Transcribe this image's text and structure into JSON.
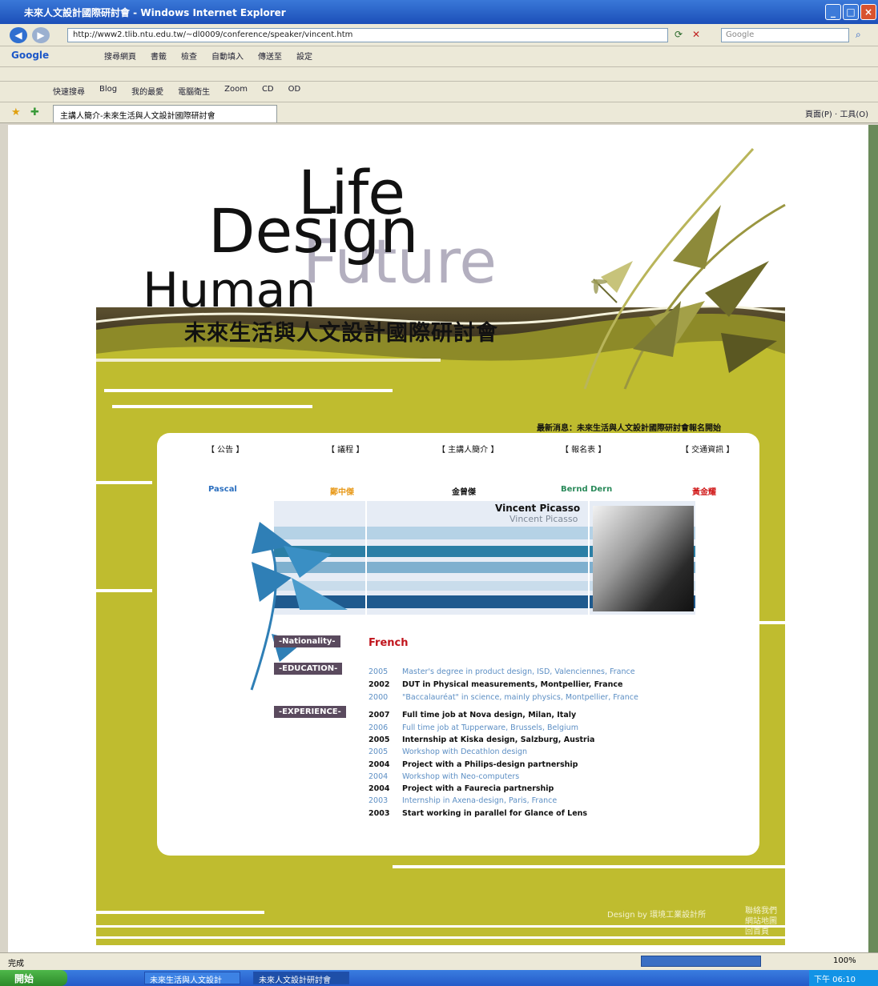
{
  "browser": {
    "title": "未來人文設計國際研討會 - Windows Internet Explorer",
    "address": "http://www2.tlib.ntu.edu.tw/~dl0009/conference/speaker/vincent.htm",
    "search_placeholder": "Google",
    "google_label": "Google",
    "toolbar_items": [
      "搜尋網頁",
      "書籤",
      "檢查",
      "自動填入",
      "傳送至",
      "設定"
    ],
    "links_toolbar": [
      "快速搜尋",
      "Blog",
      "我的最愛",
      "電腦衛生",
      "Zoom",
      "CD",
      "OD"
    ],
    "tab_title": "主講人簡介-未來生活與人文設計國際研討會",
    "tab_tools": "頁面(P) · 工具(O)",
    "status_left": "完成",
    "status_zoom": "100%",
    "taskbar": {
      "start": "開始",
      "items": [
        "未來生活與人文設計",
        "未來人文設計研討會"
      ],
      "clock": "下午 06:10"
    }
  },
  "site": {
    "title_life": "Life",
    "title_design": "Design",
    "title_future": "Future",
    "title_human": "Human",
    "title_cn": "未來生活與人文設計國際研討會",
    "marquee": "最新消息：未來生活與人文設計國際研討會報名開始",
    "nav": [
      "【 公告 】",
      "【 議程 】",
      "【 主講人簡介 】",
      "【 報名表 】",
      "【 交通資訊 】"
    ],
    "speakers": [
      {
        "name": "Pascal",
        "color": "#2b6fbf"
      },
      {
        "name": "鄭中傑",
        "color": "#e89a1b"
      },
      {
        "name": "金曾傑",
        "color": "#111111"
      },
      {
        "name": "Bernd Dern",
        "color": "#2a8a5a"
      },
      {
        "name": "黃金耀",
        "color": "#d01818"
      }
    ],
    "profile_name": "Vincent Picasso",
    "nationality_label": "-Nationality-",
    "nationality": "French",
    "education_label": "-EDUCATION-",
    "education": [
      {
        "year": "2005",
        "text": "Master's degree in product design, ISD, Valenciennes, France"
      },
      {
        "year": "2002",
        "text": "DUT in Physical measurements, Montpellier, France"
      },
      {
        "year": "2000",
        "text": "\"Baccalauréat\" in science, mainly physics, Montpellier, France"
      }
    ],
    "experience_label": "-EXPERIENCE-",
    "experience": [
      {
        "year": "2007",
        "text": "Full time job at Nova design, Milan, Italy"
      },
      {
        "year": "2006",
        "text": "Full time job at Tupperware, Brussels, Belgium"
      },
      {
        "year": "2005",
        "text": "Internship at Kiska design, Salzburg, Austria"
      },
      {
        "year": "2005",
        "text": "Workshop with Decathlon design"
      },
      {
        "year": "2004",
        "text": "Project with a Philips-design partnership"
      },
      {
        "year": "2004",
        "text": "Workshop with Neo-computers"
      },
      {
        "year": "2004",
        "text": "Project with a Faurecia partnership"
      },
      {
        "year": "2003",
        "text": "Internship in Axena-design, Paris, France"
      },
      {
        "year": "2003",
        "text": "Start working in parallel for Glance of Lens"
      }
    ],
    "footer": "Design by 環境工業設計所",
    "footer_links": [
      "聯絡我們",
      "網站地圖",
      "回首頁"
    ]
  }
}
